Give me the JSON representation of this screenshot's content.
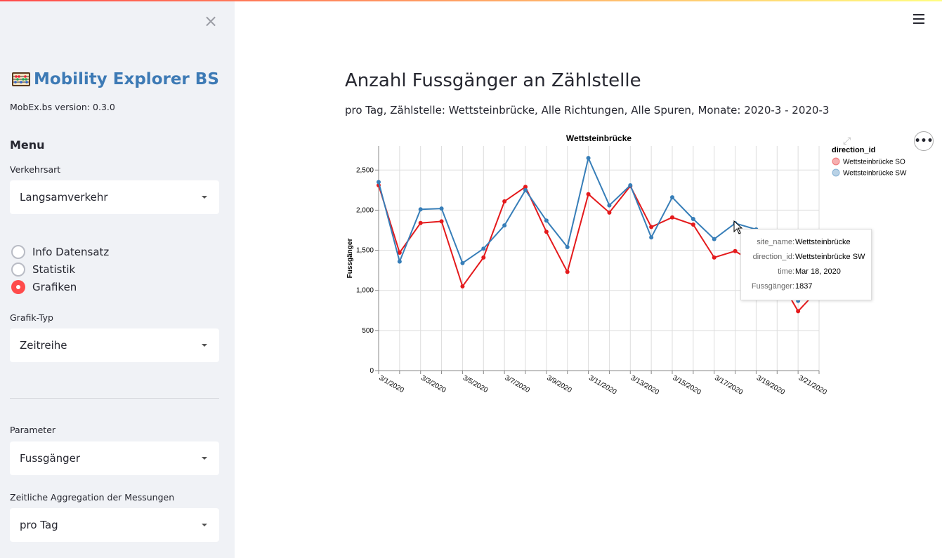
{
  "sidebar": {
    "close_icon": "close-icon",
    "app_title": "Mobility Explorer BS",
    "version": "MobEx.bs version: 0.3.0",
    "menu_heading": "Menu",
    "verkehrsart_label": "Verkehrsart",
    "verkehrsart_value": "Langsamverkehr",
    "radio_options": [
      "Info Datensatz",
      "Statistik",
      "Grafiken"
    ],
    "radio_selected": "Grafiken",
    "grafik_typ_label": "Grafik-Typ",
    "grafik_typ_value": "Zeitreihe",
    "parameter_label": "Parameter",
    "parameter_value": "Fussgänger",
    "aggregation_label": "Zeitliche Aggregation der Messungen",
    "aggregation_value": "pro Tag"
  },
  "main": {
    "title": "Anzahl Fussgänger an Zählstelle",
    "subtitle": "pro Tag, Zählstelle: Wettsteinbrücke, Alle Richtungen, Alle Spuren, Monate: 2020-3 - 2020-3",
    "menu_icon": "hamburger-icon"
  },
  "tooltip": {
    "rows": [
      {
        "key": "site_name:",
        "value": "Wettsteinbrücke"
      },
      {
        "key": "direction_id:",
        "value": "Wettsteinbrücke SW"
      },
      {
        "key": "time:",
        "value": "Mar 18, 2020"
      },
      {
        "key": "Fussgänger:",
        "value": "1837"
      }
    ]
  },
  "colors": {
    "accent": "#ff4b4b",
    "brand": "#3d7ab5",
    "series_so": "#e41a1c",
    "series_sw": "#377eb8"
  },
  "chart_data": {
    "type": "line",
    "title": "Wettsteinbrücke",
    "xlabel": "",
    "ylabel": "Fussgänger",
    "ylim": [
      0,
      2800
    ],
    "yticks": [
      0,
      500,
      1000,
      1500,
      2000,
      2500
    ],
    "ytick_labels": [
      "0",
      "500",
      "1,000",
      "1,500",
      "2,000",
      "2,500"
    ],
    "x": [
      "3/1/2020",
      "3/2/2020",
      "3/3/2020",
      "3/4/2020",
      "3/5/2020",
      "3/6/2020",
      "3/7/2020",
      "3/8/2020",
      "3/9/2020",
      "3/10/2020",
      "3/11/2020",
      "3/12/2020",
      "3/13/2020",
      "3/14/2020",
      "3/15/2020",
      "3/16/2020",
      "3/17/2020",
      "3/18/2020",
      "3/19/2020",
      "3/20/2020",
      "3/21/2020",
      "3/22/2020"
    ],
    "xtick_labels": [
      "3/1/2020",
      "3/3/2020",
      "3/5/2020",
      "3/7/2020",
      "3/9/2020",
      "3/11/2020",
      "3/13/2020",
      "3/15/2020",
      "3/17/2020",
      "3/19/2020",
      "3/21/2020"
    ],
    "legend_title": "direction_id",
    "legend_position": "top-right",
    "grid": true,
    "series": [
      {
        "name": "Wettsteinbrücke SO",
        "color": "#e41a1c",
        "values": [
          2310,
          1470,
          1840,
          1860,
          1050,
          1410,
          2110,
          2290,
          1730,
          1230,
          2200,
          1970,
          2300,
          1790,
          1910,
          1820,
          1410,
          1490,
          1330,
          1190,
          740,
          1020
        ]
      },
      {
        "name": "Wettsteinbrücke SW",
        "color": "#377eb8",
        "values": [
          2350,
          1360,
          2010,
          2020,
          1340,
          1520,
          1810,
          2250,
          1870,
          1540,
          2650,
          2060,
          2310,
          1660,
          2160,
          1890,
          1640,
          1837,
          1760,
          1290,
          870,
          1040
        ]
      }
    ]
  }
}
